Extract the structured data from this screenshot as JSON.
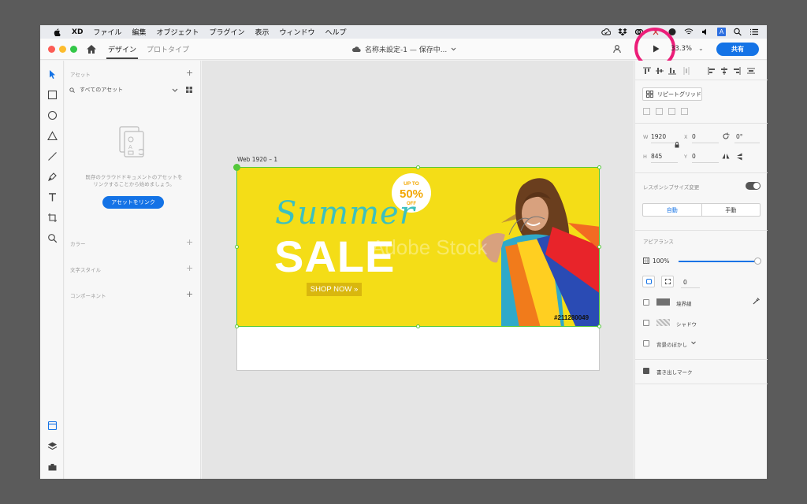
{
  "menubar": {
    "app_name": "XD",
    "items": [
      "ファイル",
      "編集",
      "オブジェクト",
      "プラグイン",
      "表示",
      "ウィンドウ",
      "ヘルプ"
    ],
    "input_badge": "A"
  },
  "titlebar": {
    "tabs": [
      "デザイン",
      "プロトタイプ"
    ],
    "doc_title": "名称未設定-1 — 保存中...",
    "zoom": "33.3%",
    "share_label": "共有"
  },
  "assets_panel": {
    "title": "アセット",
    "search_placeholder": "すべてのアセット",
    "empty_message_line1": "既存のクラウドドキュメントのアセットを",
    "empty_message_line2": "リンクすることから始めましょう。",
    "link_button": "アセットをリンク",
    "sections": [
      "カラー",
      "文字スタイル",
      "コンポーネント"
    ]
  },
  "canvas": {
    "artboard_name": "Web 1920 – 1",
    "banner": {
      "badge_top": "UP TO",
      "badge_main": "50%",
      "badge_bottom": "OFF",
      "script_text": "Summer",
      "headline": "SALE",
      "cta": "SHOP NOW »",
      "watermark": "Adobe Stock",
      "stock_id": "#211280049"
    }
  },
  "properties": {
    "repeat_grid": "リピートグリッド",
    "w_label": "W",
    "w_value": "1920",
    "x_label": "X",
    "x_value": "0",
    "h_label": "H",
    "h_value": "845",
    "y_label": "Y",
    "y_value": "0",
    "rotation": "0°",
    "responsive_label": "レスポンシブサイズ変更",
    "responsive_auto": "自動",
    "responsive_manual": "手動",
    "appearance_label": "アピアランス",
    "opacity": "100%",
    "opacity_level": 1.0,
    "corner_radius": "0",
    "border_label": "境界線",
    "shadow_label": "シャドウ",
    "blur_label": "背景のぼかし",
    "export_label": "書き出しマーク"
  },
  "colors": {
    "accent": "#1473e6",
    "highlight": "#ec1e79",
    "banner_bg": "#f4dd17",
    "selection": "#54c83a"
  }
}
